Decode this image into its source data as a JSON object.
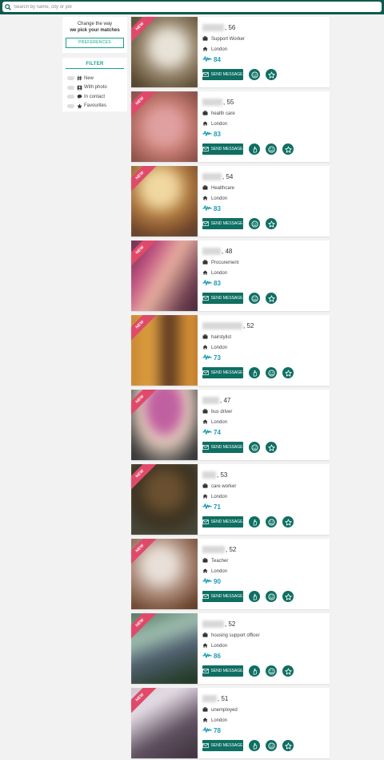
{
  "search": {
    "placeholder": "Search by name, city or job"
  },
  "preferences": {
    "title_line1": "Change the way",
    "title_line2": "we pick your matches",
    "button_label": "PREFERENCES"
  },
  "filter": {
    "title": "FILTER",
    "items": [
      {
        "label": "New",
        "icon": "hash-icon"
      },
      {
        "label": "With photo",
        "icon": "photo-icon"
      },
      {
        "label": "In contact",
        "icon": "chat-icon"
      },
      {
        "label": "Favourites",
        "icon": "star-icon"
      }
    ]
  },
  "badge_label": "NEW",
  "send_message_label": "SEND MESSAGE",
  "colors": {
    "brand": "#0f6f62",
    "accent": "#15a38a",
    "score": "#1c9bb6",
    "ribbon": "#e04a6a",
    "topbar": "#0f5a4f"
  },
  "profiles": [
    {
      "age": ", 56",
      "job": "Support Worker",
      "city": "London",
      "score": "84",
      "extra_action": false
    },
    {
      "age": ", 55",
      "job": "health care",
      "city": "London",
      "score": "83",
      "extra_action": true
    },
    {
      "age": ", 54",
      "job": "Healthcare",
      "city": "London",
      "score": "83",
      "extra_action": false
    },
    {
      "age": ", 48",
      "job": "Procurement",
      "city": "London",
      "score": "83",
      "extra_action": false
    },
    {
      "age": ", 52",
      "job": "hairstylist",
      "city": "London",
      "score": "73",
      "extra_action": true
    },
    {
      "age": ", 47",
      "job": "bus driver",
      "city": "London",
      "score": "74",
      "extra_action": false
    },
    {
      "age": ", 53",
      "job": "care worker",
      "city": "London",
      "score": "71",
      "extra_action": true
    },
    {
      "age": ", 52",
      "job": "Teacher",
      "city": "London",
      "score": "90",
      "extra_action": true
    },
    {
      "age": ", 52",
      "job": "housing support officer",
      "city": "London",
      "score": "86",
      "extra_action": true
    },
    {
      "age": ", 51",
      "job": "unemployed",
      "city": "London",
      "score": "78",
      "extra_action": true
    }
  ]
}
